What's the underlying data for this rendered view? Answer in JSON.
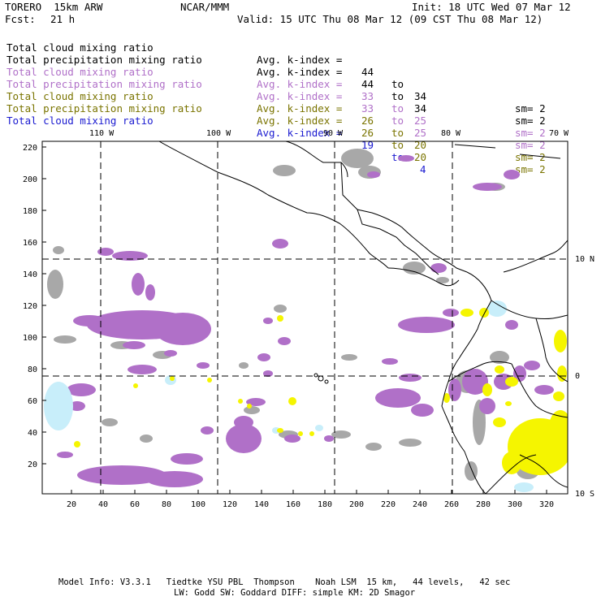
{
  "header": {
    "model": "TORERO  15km ARW",
    "center": "NCAR/MMM",
    "init": "Init: 18 UTC Wed 07 Mar 12",
    "fcst_label": "Fcst:",
    "fcst_value": "21 h",
    "valid": "Valid: 15 UTC Thu 08 Mar 12 (09 CST Thu 08 Mar 12)"
  },
  "legend": [
    {
      "name": "Total cloud mixing ratio",
      "kindex": "Avg. k-index =",
      "from": "44",
      "to": "to",
      "to_val": "34",
      "sm": "sm= 2",
      "color": "black"
    },
    {
      "name": "Total precipitation mixing ratio",
      "kindex": "Avg. k-index =",
      "from": "44",
      "to": "to",
      "to_val": "34",
      "sm": "sm= 2",
      "color": "black"
    },
    {
      "name": "Total cloud mixing ratio",
      "kindex": "Avg. k-index =",
      "from": "33",
      "to": "to",
      "to_val": "25",
      "sm": "sm= 2",
      "color": "violet"
    },
    {
      "name": "Total precipitation mixing ratio",
      "kindex": "Avg. k-index =",
      "from": "33",
      "to": "to",
      "to_val": "25",
      "sm": "sm= 2",
      "color": "violet"
    },
    {
      "name": "Total cloud mixing ratio",
      "kindex": "Avg. k-index =",
      "from": "26",
      "to": "to",
      "to_val": "20",
      "sm": "sm= 2",
      "color": "olive"
    },
    {
      "name": "Total precipitation mixing ratio",
      "kindex": "Avg. k-index =",
      "from": "26",
      "to": "to",
      "to_val": "20",
      "sm": "sm= 2",
      "color": "olive"
    },
    {
      "name": "Total cloud mixing ratio",
      "kindex": "Avg. k-index =",
      "from": "19",
      "to": "to",
      "to_val": "4",
      "sm": "",
      "color": "blue"
    }
  ],
  "map": {
    "top_longitudes": [
      "110 W",
      "100 W",
      "90 W",
      "80 W",
      "70 W"
    ],
    "right_latitudes": [
      "10 N",
      "0",
      "10 S"
    ],
    "y_ticks": [
      "220",
      "200",
      "180",
      "160",
      "140",
      "120",
      "100",
      "80",
      "60",
      "40",
      "20"
    ],
    "x_ticks": [
      "20",
      "40",
      "60",
      "80",
      "100",
      "120",
      "140",
      "160",
      "180",
      "200",
      "220",
      "240",
      "260",
      "280",
      "300",
      "320"
    ],
    "colors": {
      "gray": "#a8a8a8",
      "violet": "#b070c8",
      "yellow": "#f5f500",
      "lightblue": "#c8eefa"
    }
  },
  "footer": {
    "line1": "Model Info: V3.3.1   Tiedtke YSU PBL  Thompson    Noah LSM  15 km,   44 levels,   42 sec",
    "line2": "LW: Godd SW: Goddard DIFF: simple KM: 2D Smagor"
  }
}
